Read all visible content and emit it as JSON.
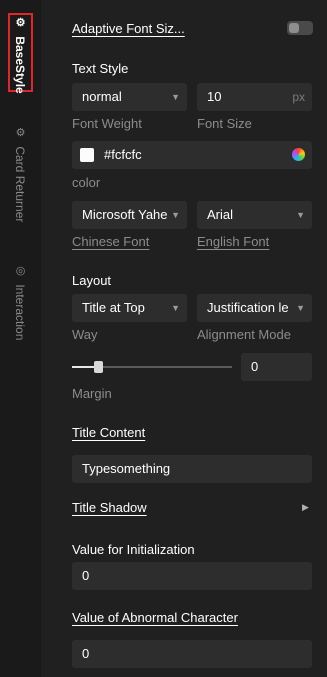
{
  "rail": {
    "tabs": [
      {
        "label": "BaseStyle",
        "icon": "sliders-icon"
      },
      {
        "label": "Card Returner",
        "icon": "sliders-icon"
      },
      {
        "label": "Interaction",
        "icon": "interaction-icon"
      }
    ]
  },
  "adaptive": {
    "label": "Adaptive Font Siz...",
    "enabled": false
  },
  "text_style": {
    "title": "Text Style",
    "font_weight": {
      "value": "normal",
      "label": "Font Weight"
    },
    "font_size": {
      "value": "10",
      "unit": "px",
      "label": "Font Size"
    },
    "color": {
      "value": "#fcfcfc",
      "label": "color"
    },
    "chinese_font": {
      "value": "Microsoft Yahe",
      "label": "Chinese Font"
    },
    "english_font": {
      "value": "Arial",
      "label": "English Font"
    }
  },
  "layout": {
    "title": "Layout",
    "way": {
      "value": "Title at Top",
      "label": "Way"
    },
    "alignment": {
      "value": "Justification le",
      "label": "Alignment Mode"
    },
    "margin": {
      "value": "0",
      "label": "Margin"
    }
  },
  "title_content": {
    "label": "Title Content",
    "value": "Typesomething"
  },
  "title_shadow": {
    "label": "Title Shadow"
  },
  "init_value": {
    "label": "Value for Initialization",
    "value": "0"
  },
  "abnormal": {
    "label": "Value of Abnormal Character",
    "value": "0"
  },
  "colors": {
    "accent_outline": "#e0262b",
    "panel": "#202020",
    "field": "#2d2d2d"
  }
}
